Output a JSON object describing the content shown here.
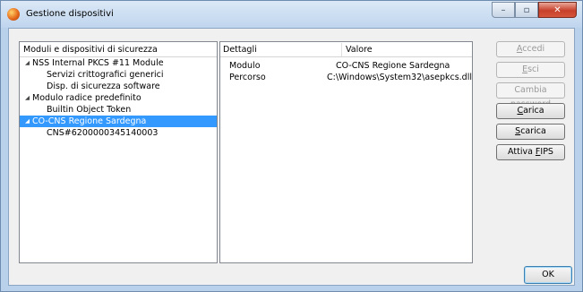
{
  "window": {
    "title": "Gestione dispositivi",
    "controls": {
      "minimize": "–",
      "maximize": "▫",
      "close": "✕"
    }
  },
  "tree": {
    "header": "Moduli e dispositivi di sicurezza",
    "items": [
      {
        "label": "NSS Internal PKCS #11 Module",
        "level": 1,
        "expanded": true
      },
      {
        "label": "Servizi crittografici generici",
        "level": 2
      },
      {
        "label": "Disp. di sicurezza software",
        "level": 2
      },
      {
        "label": "Modulo radice predefinito",
        "level": 1,
        "expanded": true
      },
      {
        "label": "Builtin Object Token",
        "level": 2
      },
      {
        "label": "CO-CNS Regione Sardegna",
        "level": 1,
        "expanded": true,
        "selected": true
      },
      {
        "label": "CNS#6200000345140003",
        "level": 2
      }
    ]
  },
  "details": {
    "col1": "Dettagli",
    "col2": "Valore",
    "rows": [
      {
        "key": "Modulo",
        "value": "CO-CNS Regione Sardegna"
      },
      {
        "key": "Percorso",
        "value": "C:\\Windows\\System32\\asepkcs.dll"
      }
    ]
  },
  "buttons": {
    "accedi": {
      "pre": "",
      "u": "A",
      "post": "ccedi"
    },
    "esci": {
      "pre": "",
      "u": "E",
      "post": "sci"
    },
    "cambia_password": "Cambia password",
    "carica": {
      "pre": "",
      "u": "C",
      "post": "arica"
    },
    "scarica": {
      "pre": "",
      "u": "S",
      "post": "carica"
    },
    "attiva_fips": {
      "pre": "Attiva ",
      "u": "F",
      "post": "IPS"
    },
    "ok": "OK"
  },
  "colors": {
    "selection": "#3399ff",
    "window_frame": "#b9d1ea"
  }
}
